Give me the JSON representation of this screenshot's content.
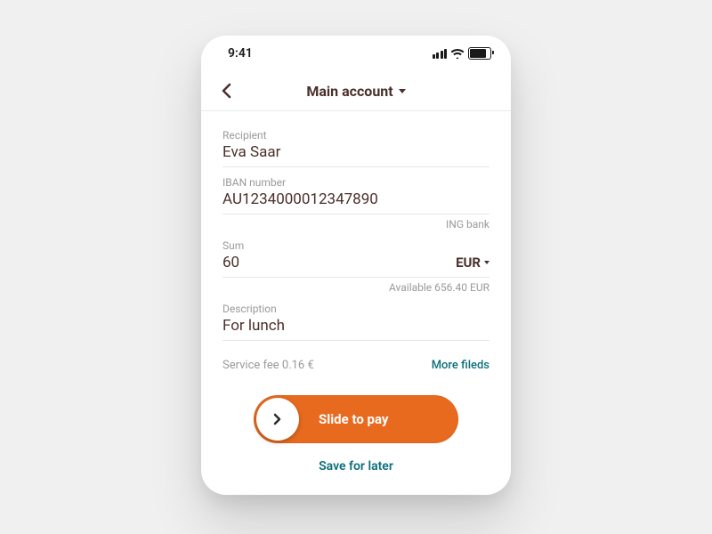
{
  "status": {
    "time": "9:41"
  },
  "header": {
    "title": "Main account"
  },
  "fields": {
    "recipient": {
      "label": "Recipient",
      "value": "Eva Saar"
    },
    "iban": {
      "label": "IBAN number",
      "value": "AU1234000012347890",
      "bank": "ING bank"
    },
    "sum": {
      "label": "Sum",
      "value": "60",
      "currency": "EUR",
      "available": "Available 656.40 EUR"
    },
    "description": {
      "label": "Description",
      "value": "For lunch"
    }
  },
  "fee": "Service fee 0.16 €",
  "more_fields": "More fileds",
  "slide_label": "Slide to pay",
  "save_label": "Save for later"
}
